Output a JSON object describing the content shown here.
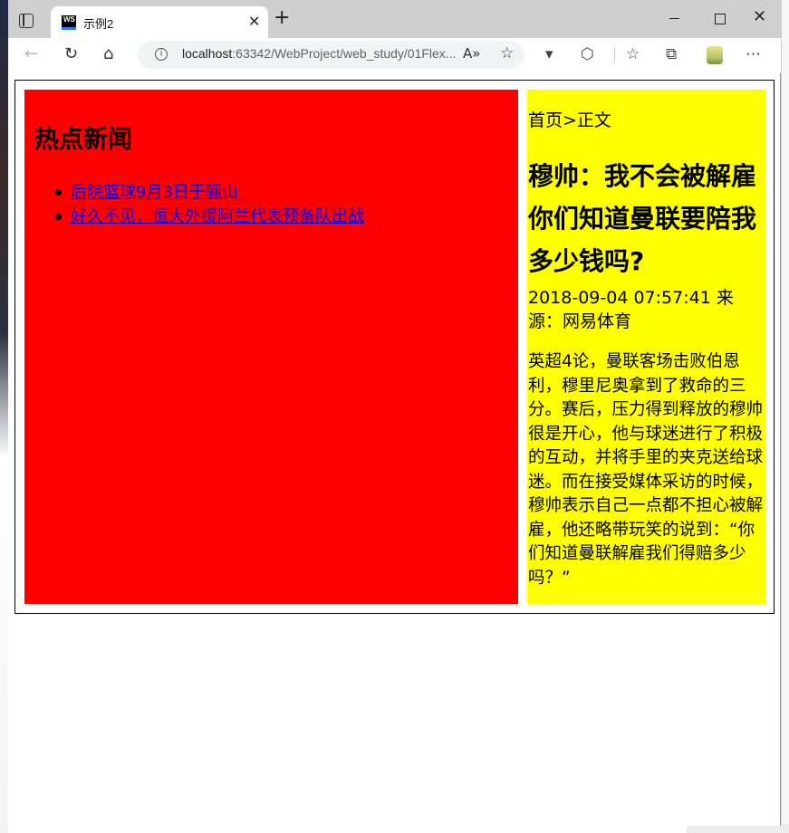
{
  "browser": {
    "tab": {
      "title": "示例2",
      "favicon_text": "WS"
    },
    "address": {
      "host": "localhost",
      "path": ":63342/WebProject/web_study/01Flex..."
    },
    "icons": {
      "tab_actions": "tab-actions-icon",
      "close": "close-icon",
      "new_tab": "plus-icon",
      "back": "back-arrow-icon",
      "refresh": "refresh-icon",
      "home": "home-icon",
      "info": "info-icon",
      "read_aloud": "read-aloud-icon",
      "add_favorite": "add-favorite-icon",
      "extensions": "extensions-icon",
      "favorites": "favorites-icon",
      "collections": "collections-icon",
      "profile": "profile-icon",
      "menu": "more-menu-icon"
    }
  },
  "page": {
    "left": {
      "heading": "热点新闻",
      "links": [
        "后院篮球9月3日于骊山",
        "好久不见，恒大外援阿兰代表预备队出战"
      ],
      "background": "#ff0000"
    },
    "right": {
      "breadcrumb": "首页>正文",
      "title": "穆帅：我不会被解雇 你们知道曼联要陪我多少钱吗?",
      "meta": "2018-09-04 07:57:41 来源：网易体育",
      "body": "英超4论，曼联客场击败伯恩利，穆里尼奥拿到了救命的三分。赛后，压力得到释放的穆帅很是开心，他与球迷进行了积极的互动，并将手里的夹克送给球迷。而在接受媒体采访的时候，穆帅表示自己一点都不担心被解雇，他还略带玩笑的说到：“你们知道曼联解雇我们得赔多少吗？”",
      "background": "#ffff00"
    }
  }
}
